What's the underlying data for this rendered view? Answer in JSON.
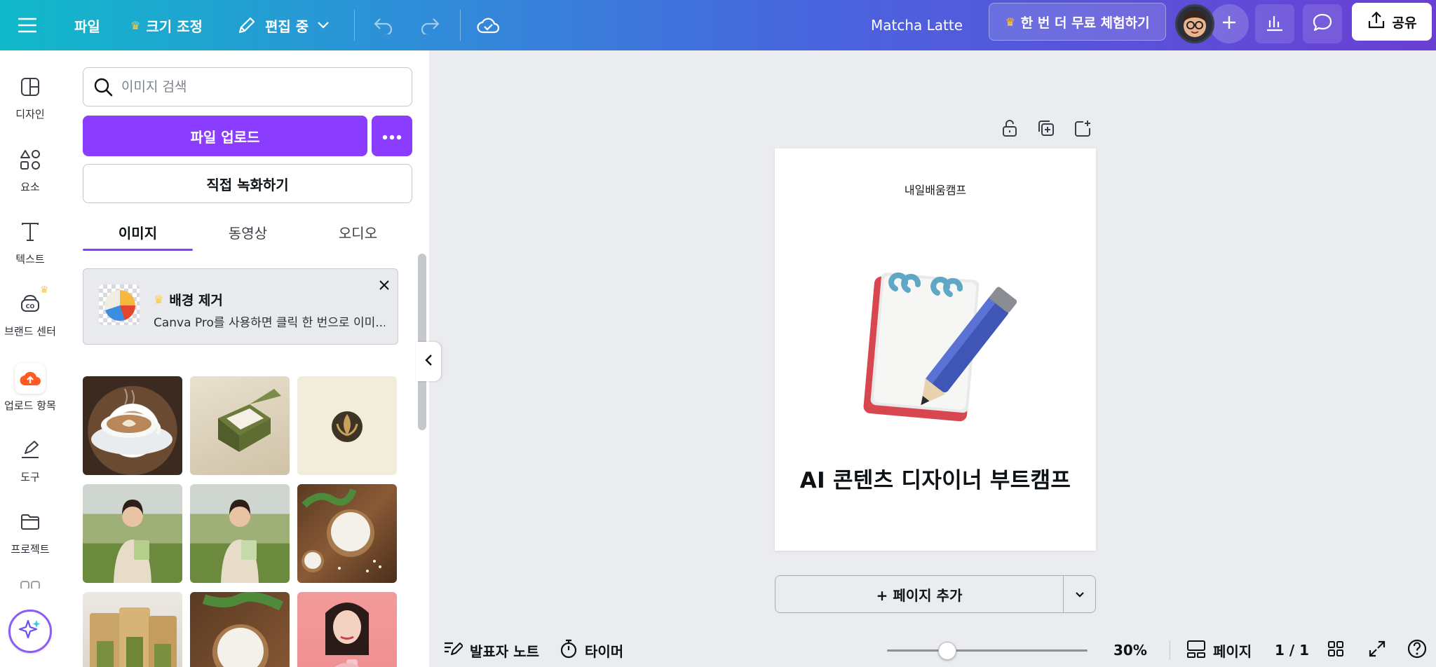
{
  "topbar": {
    "menu_icon": "hamburger-menu-icon",
    "file_label": "파일",
    "resize_label": "크기 조정",
    "edit_mode_label": "편집 중",
    "project_title": "Matcha Latte",
    "trial_label": "한 번 더 무료 체험하기",
    "share_label": "공유"
  },
  "rail": {
    "items": [
      {
        "label": "디자인",
        "icon": "design-template-icon"
      },
      {
        "label": "요소",
        "icon": "elements-shapes-icon"
      },
      {
        "label": "텍스트",
        "icon": "text-t-icon"
      },
      {
        "label": "브랜드 센터",
        "icon": "brand-kit-icon"
      },
      {
        "label": "업로드 항목",
        "icon": "cloud-upload-icon"
      },
      {
        "label": "도구",
        "icon": "draw-pen-icon"
      },
      {
        "label": "프로젝트",
        "icon": "folder-icon"
      }
    ]
  },
  "panel": {
    "search_placeholder": "이미지 검색",
    "upload_label": "파일 업로드",
    "record_label": "직접 녹화하기",
    "tabs": [
      "이미지",
      "동영상",
      "오디오"
    ],
    "promo": {
      "title": "배경 제거",
      "description": "Canva Pro를 사용하면 클릭 한 번으로 이미..."
    },
    "images": [
      "latte-art-coffee",
      "green-box-rice",
      "rice-leaf-logo",
      "woman-field-holding-package",
      "woman-field-holding-package-2",
      "rice-bowl-wooden-table",
      "rice-bag-packages",
      "rice-bowl-herbs",
      "woman-pink-background"
    ]
  },
  "canvas": {
    "page_org_text": "내일배움캠프",
    "page_title": "AI 콘텐츠 디자이너 부트캠프",
    "add_page_label": "+ 페이지 추가"
  },
  "bottombar": {
    "notes_label": "발표자 노트",
    "timer_label": "타이머",
    "zoom_label": "30%",
    "zoom_fraction": 0.3,
    "pages_label": "페이지",
    "page_counter": "1 / 1"
  },
  "colors": {
    "accent_purple": "#8b3dff",
    "topbar_gradient_start": "#10b9c9",
    "topbar_gradient_end": "#6a3fd4",
    "crown": "#ffc83d",
    "upload_orange": "#ff5a1f"
  }
}
